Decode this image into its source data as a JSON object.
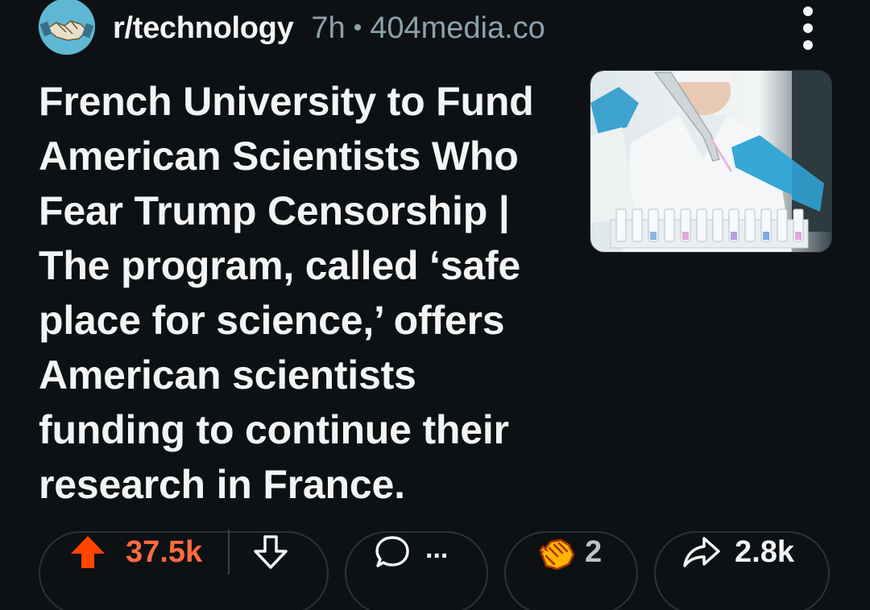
{
  "post": {
    "subreddit": "r/technology",
    "time_ago": "7h",
    "separator": "•",
    "domain": "404media.co",
    "title": "French University to Fund American Scientists Who Fear Trump Censorship | The program, called ‘safe place for science,’ offers American scientists funding to continue their research in France.",
    "thumbnail_alt": "Scientist with pipette and test tubes"
  },
  "actions": {
    "upvotes": "37.5k",
    "comments": "...",
    "awards": "2",
    "shares": "2.8k"
  },
  "colors": {
    "background": "#0e1113",
    "upvote_accent": "#ff6a3d",
    "meta_text": "#8ba2ad",
    "pill_border": "#2b3236"
  },
  "icons": {
    "avatar": "handshake-avatar-icon",
    "menu": "kebab-menu-icon",
    "upvote": "upvote-arrow-icon",
    "downvote": "downvote-arrow-icon",
    "comment": "comment-bubble-icon",
    "award": "award-hands-icon",
    "share": "share-arrow-icon"
  }
}
